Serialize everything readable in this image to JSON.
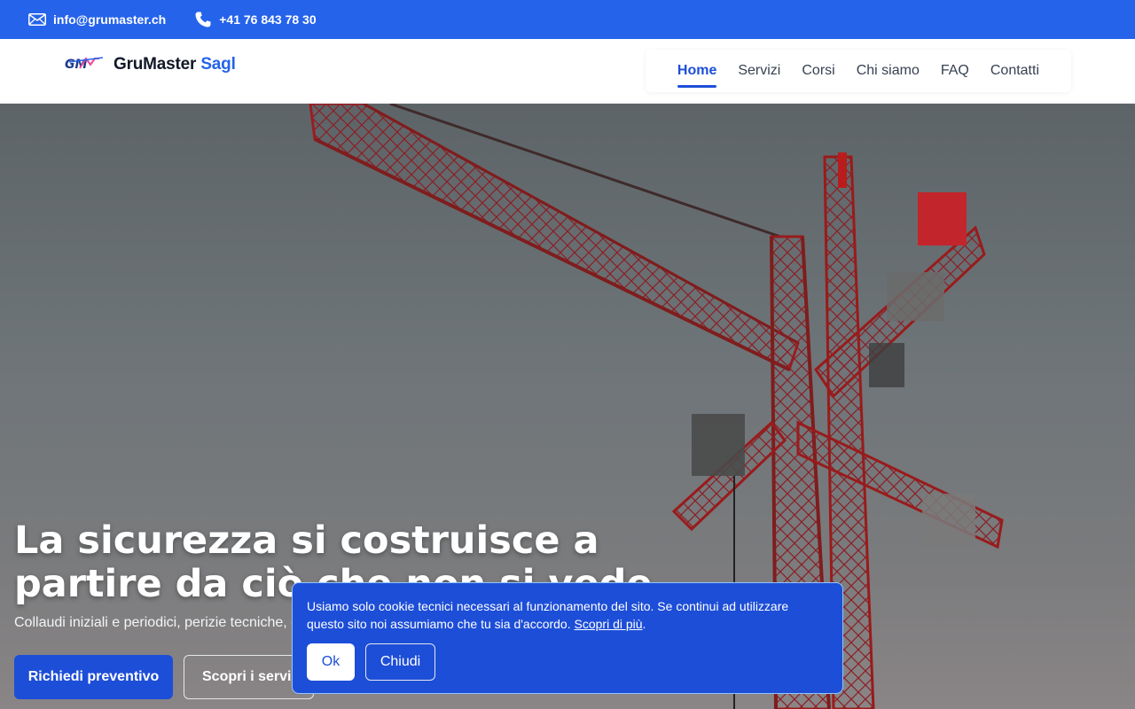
{
  "topbar": {
    "email": "info@grumaster.ch",
    "phone": "+41 76 843 78 30",
    "email_icon": "mail-icon",
    "phone_icon": "phone-icon",
    "bg_color": "#2563eb"
  },
  "header": {
    "logo_mark": "GM",
    "brand_name": "GruMaster",
    "brand_suffix": "Sagl",
    "nav": [
      {
        "label": "Home",
        "active": true
      },
      {
        "label": "Servizi",
        "active": false
      },
      {
        "label": "Corsi",
        "active": false
      },
      {
        "label": "Chi siamo",
        "active": false
      },
      {
        "label": "FAQ",
        "active": false
      },
      {
        "label": "Contatti",
        "active": false
      }
    ],
    "accent_color": "#1d4ed8"
  },
  "hero": {
    "title": "La sicurezza si costruisce a partire da ciò che non si vede",
    "subtitle": "Collaudi iniziali e periodici, perizie tecniche, consulenze e corsi di formazione per gru e macchine da cantiere.",
    "primary_button": "Richiedi preventivo",
    "secondary_button": "Scopri i servizi",
    "image": "tower-crane-photo"
  },
  "cookie_banner": {
    "text": "Usiamo solo cookie tecnici necessari al funzionamento del sito. Se continui ad utilizzare questo sito noi assumiamo che tu sia d'accordo.",
    "link": "Scopri di più",
    "ok_label": "Ok",
    "close_label": "Chiudi"
  }
}
